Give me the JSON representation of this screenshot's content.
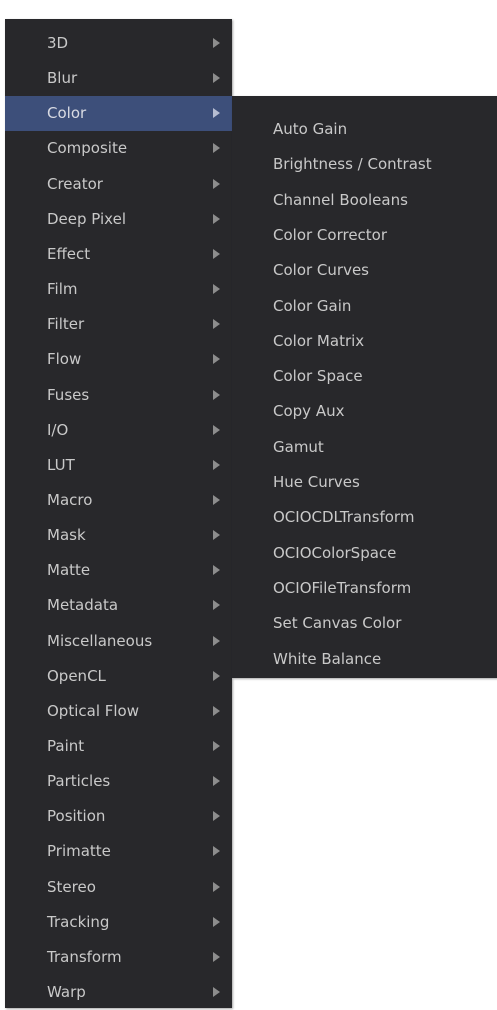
{
  "main_menu": {
    "items": [
      {
        "label": "3D",
        "active": false
      },
      {
        "label": "Blur",
        "active": false
      },
      {
        "label": "Color",
        "active": true
      },
      {
        "label": "Composite",
        "active": false
      },
      {
        "label": "Creator",
        "active": false
      },
      {
        "label": "Deep Pixel",
        "active": false
      },
      {
        "label": "Effect",
        "active": false
      },
      {
        "label": "Film",
        "active": false
      },
      {
        "label": "Filter",
        "active": false
      },
      {
        "label": "Flow",
        "active": false
      },
      {
        "label": "Fuses",
        "active": false
      },
      {
        "label": "I/O",
        "active": false
      },
      {
        "label": "LUT",
        "active": false
      },
      {
        "label": "Macro",
        "active": false
      },
      {
        "label": "Mask",
        "active": false
      },
      {
        "label": "Matte",
        "active": false
      },
      {
        "label": "Metadata",
        "active": false
      },
      {
        "label": "Miscellaneous",
        "active": false
      },
      {
        "label": "OpenCL",
        "active": false
      },
      {
        "label": "Optical Flow",
        "active": false
      },
      {
        "label": "Paint",
        "active": false
      },
      {
        "label": "Particles",
        "active": false
      },
      {
        "label": "Position",
        "active": false
      },
      {
        "label": "Primatte",
        "active": false
      },
      {
        "label": "Stereo",
        "active": false
      },
      {
        "label": "Tracking",
        "active": false
      },
      {
        "label": "Transform",
        "active": false
      },
      {
        "label": "Warp",
        "active": false
      }
    ]
  },
  "sub_menu": {
    "items": [
      {
        "label": "Auto Gain"
      },
      {
        "label": "Brightness / Contrast"
      },
      {
        "label": "Channel Booleans"
      },
      {
        "label": "Color Corrector"
      },
      {
        "label": "Color Curves"
      },
      {
        "label": "Color Gain"
      },
      {
        "label": "Color Matrix"
      },
      {
        "label": "Color Space"
      },
      {
        "label": "Copy Aux"
      },
      {
        "label": "Gamut"
      },
      {
        "label": "Hue Curves"
      },
      {
        "label": "OCIOCDLTransform"
      },
      {
        "label": "OCIOColorSpace"
      },
      {
        "label": "OCIOFileTransform"
      },
      {
        "label": "Set Canvas Color"
      },
      {
        "label": "White Balance"
      }
    ]
  },
  "colors": {
    "menu_background": "#28282b",
    "highlight": "#3d4f7a",
    "text": "#c9c9c9",
    "arrow": "#8d8d8d"
  },
  "icons": {
    "submenu_arrow": "submenu-arrow-icon"
  }
}
